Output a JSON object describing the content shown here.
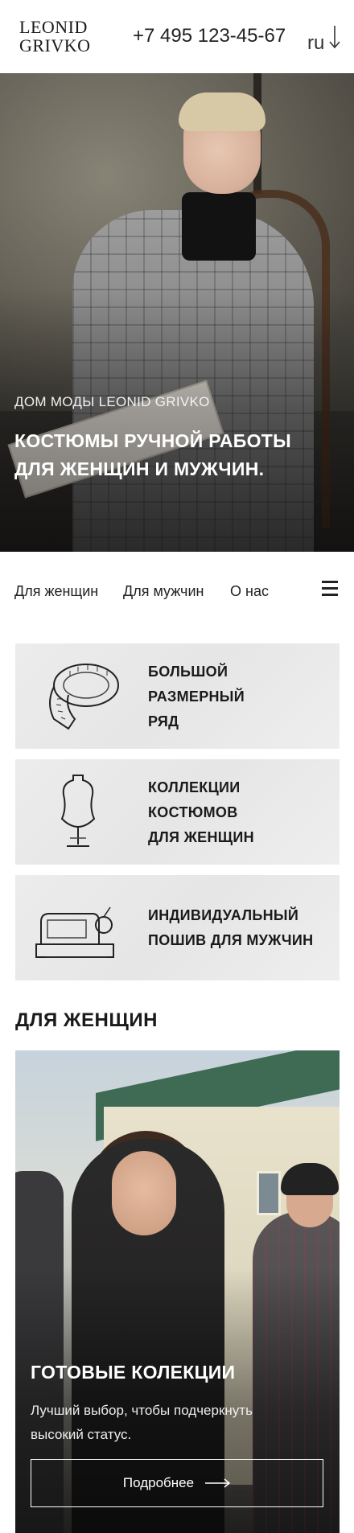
{
  "header": {
    "logo_line1": "LEONID",
    "logo_line2": "GRIVKO",
    "phone": "+7 495 123-45-67",
    "lang": "ru",
    "lang_icon": "arrow-down-icon"
  },
  "hero": {
    "eyebrow": "ДОМ МОДЫ LEONID GRIVKO",
    "title": "КОСТЮМЫ РУЧНОЙ РАБОТЫ ДЛЯ ЖЕНЩИН И МУЖЧИН."
  },
  "nav": {
    "items": [
      {
        "label": "Для женщин"
      },
      {
        "label": "Для мужчин"
      },
      {
        "label": "О нас"
      }
    ],
    "menu_icon": "hamburger-menu-icon"
  },
  "cards": [
    {
      "label": "БОЛЬШОЙ\nРАЗМЕРНЫЙ\nРЯД",
      "icon": "measuring-tape-icon"
    },
    {
      "label": "КОЛЛЕКЦИИ\nКОСТЮМОВ\nДЛЯ ЖЕНЩИН",
      "icon": "dress-form-icon"
    },
    {
      "label": "ИНДИВИДУАЛЬНЫЙ\nПОШИВ ДЛЯ МУЖЧИН",
      "icon": "sewing-machine-icon"
    }
  ],
  "section": {
    "title": "ДЛЯ ЖЕНЩИН"
  },
  "promo": {
    "title": "ГОТОВЫЕ КОЛЕКЦИИ",
    "text": "Лучший выбор, чтобы подчеркнуть высокий статус.",
    "button_label": "Подробнее",
    "button_icon": "arrow-right-icon"
  }
}
